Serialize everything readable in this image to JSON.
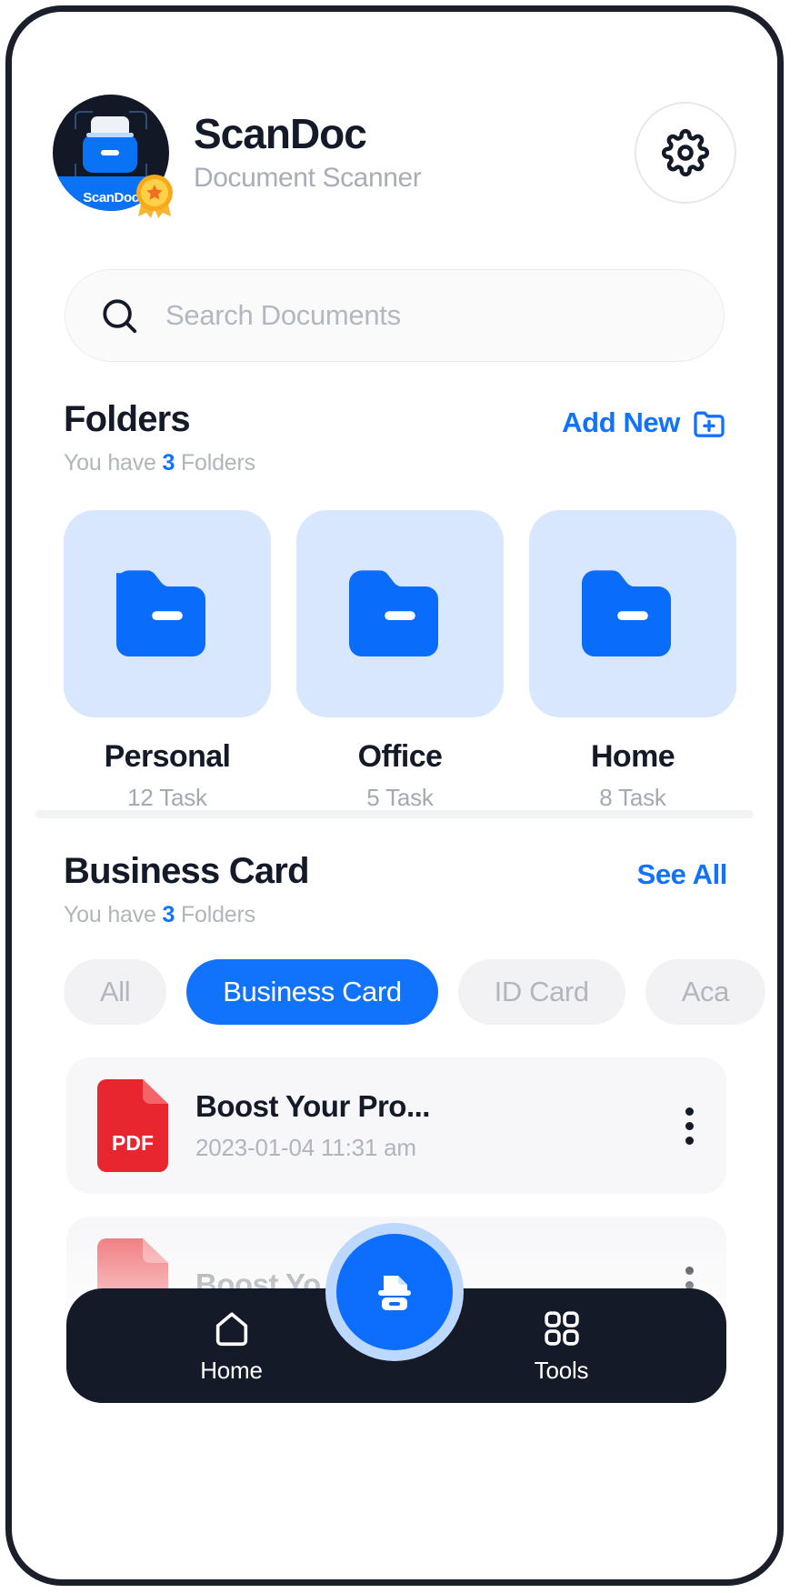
{
  "app": {
    "title": "ScanDoc",
    "subtitle": "Document Scanner",
    "logo_badge_text": "ScanDoc",
    "settings_icon": "gear-icon",
    "accent_color": "#1173fb",
    "dark_color": "#141a27"
  },
  "search": {
    "placeholder": "Search Documents",
    "icon": "search-icon"
  },
  "folders_section": {
    "title": "Folders",
    "subtitle_prefix": "You have ",
    "count": "3",
    "subtitle_suffix": " Folders",
    "action_label": "Add New",
    "action_icon": "folder-plus-icon",
    "items": [
      {
        "name": "Personal",
        "tasks": "12 Task",
        "icon": "folder-icon"
      },
      {
        "name": "Office",
        "tasks": "5 Task",
        "icon": "folder-icon"
      },
      {
        "name": "Home",
        "tasks": "8 Task",
        "icon": "folder-icon"
      }
    ]
  },
  "business_section": {
    "title": "Business Card",
    "subtitle_prefix": "You have ",
    "count": "3",
    "subtitle_suffix": " Folders",
    "action_label": "See All",
    "chips": [
      {
        "label": "All",
        "active": false
      },
      {
        "label": "Business Card",
        "active": true
      },
      {
        "label": "ID Card",
        "active": false
      },
      {
        "label": "Aca",
        "active": false
      }
    ],
    "documents": [
      {
        "title": "Boost Your Pro...",
        "date": "2023-01-04 11:31 am",
        "file_type": "PDF",
        "menu_icon": "more-vertical-icon"
      },
      {
        "title": "Boost Yo",
        "date": "",
        "file_type": "PDF",
        "menu_icon": "more-vertical-icon"
      }
    ]
  },
  "bottom_nav": {
    "items": [
      {
        "label": "Home",
        "icon": "home-icon"
      },
      {
        "label": "Tools",
        "icon": "grid-icon"
      }
    ],
    "fab_icon": "scanner-icon"
  }
}
